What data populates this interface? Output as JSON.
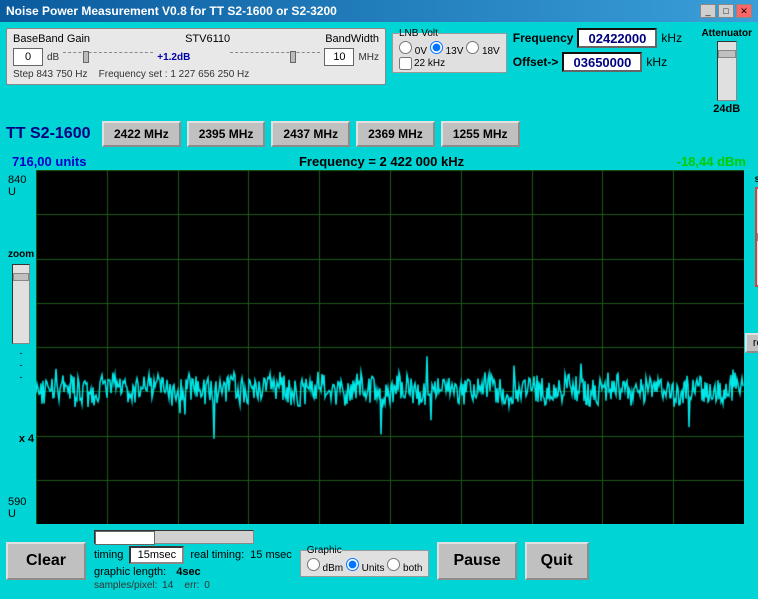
{
  "window": {
    "title": "Noise Power Measurement V0.8 for TT S2-1600 or S2-3200"
  },
  "controls": {
    "baseband_gain_label": "BaseBand Gain",
    "stv_label": "STV6110",
    "bandwidth_label": "BandWidth",
    "gain_value": "0",
    "gain_unit": "dB",
    "gain_offset": "+1.2dB",
    "bandwidth_value": "10",
    "bandwidth_unit": "MHz",
    "step_freq": "Step 843 750 Hz",
    "freq_set": "Frequency set : 1 227 656 250 Hz",
    "lnb_volt_label": "LNB Volt",
    "lnb_0v": "0V",
    "lnb_13v": "13V",
    "lnb_18v": "18V",
    "lnb_22khz": "22 kHz",
    "freq_label": "Frequency",
    "freq_value": "02422000",
    "freq_unit": "kHz",
    "offset_label": "Offset->",
    "offset_value": "03650000",
    "offset_unit": "kHz",
    "attenuator_label": "Attenuator",
    "attenuator_value": "24dB"
  },
  "device": {
    "label": "TT S2-1600"
  },
  "freq_buttons": [
    "2422 MHz",
    "2395 MHz",
    "2437 MHz",
    "2369 MHz",
    "1255 MHz"
  ],
  "chart": {
    "y_top": "840 U",
    "y_bottom": "590 U",
    "zoom_label": "zoom",
    "zoom_x": "x 4",
    "shift_label": "shift",
    "units_display": "716,00 units",
    "freq_display": "Frequency = 2 422 000 kHz",
    "dbm_display": "-18,44 dBm"
  },
  "bottom": {
    "clear_label": "Clear",
    "real_timing_label": "real timing:",
    "real_timing_value": "15 msec",
    "timing_label": "timing",
    "timing_value": "15msec",
    "graphic_length_label": "graphic length:",
    "graphic_length_value": "4sec",
    "samples_label": "samples/pixel:",
    "samples_value": "14",
    "err_label": "err:",
    "err_value": "0",
    "graphic_label": "Graphic",
    "radio_dbm": "dBm",
    "radio_units": "Units",
    "radio_both": "both",
    "pause_label": "Pause",
    "quit_label": "Quit",
    "reset_label": "reset"
  }
}
